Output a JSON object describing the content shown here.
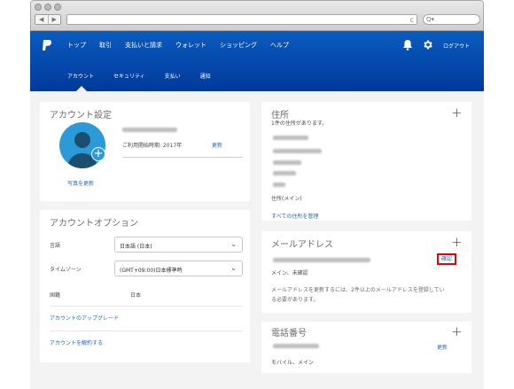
{
  "browser": {
    "back": "◀",
    "forward": "▶",
    "reload": "c",
    "search_prefix": "Q▾"
  },
  "nav": {
    "main": [
      "トップ",
      "取引",
      "支払いと請求",
      "ウォレット",
      "ショッピング",
      "ヘルプ"
    ],
    "logout": "ログアウト",
    "sub": [
      "アカウント",
      "セキュリティ",
      "支払い",
      "通知"
    ]
  },
  "account_settings": {
    "title": "アカウント設定",
    "since": "ご利用開始時期: 2017年",
    "update": "更新",
    "update_photo": "写真を更新"
  },
  "account_options": {
    "title": "アカウントオプション",
    "language_label": "言語",
    "language_value": "日本語 (日本)",
    "timezone_label": "タイムゾーン",
    "timezone_value": "(GMT+09:00)日本標準時",
    "country_label": "国籍",
    "country_value": "日本",
    "upgrade": "アカウントのアップグレード",
    "close": "アカウントを解約する"
  },
  "address": {
    "title": "住所",
    "count": "1件の住所があります。",
    "main": "住所(メイン)",
    "manage": "すべての住所を管理"
  },
  "email": {
    "title": "メールアドレス",
    "status": "メイン、未確認",
    "verify": "確認",
    "note_line1": "メールアドレスを更新するには、2件以上のメールアドレスを登録してい",
    "note_line2": "る必要があります。"
  },
  "phone": {
    "title": "電話番号",
    "update": "更新",
    "type": "モバイル、メイン"
  },
  "icons": {
    "bell": "bell-icon",
    "gear": "gear-icon",
    "logo": "paypal-logo-icon",
    "plus": "plus-icon",
    "chevron": "chevron-down-icon"
  }
}
